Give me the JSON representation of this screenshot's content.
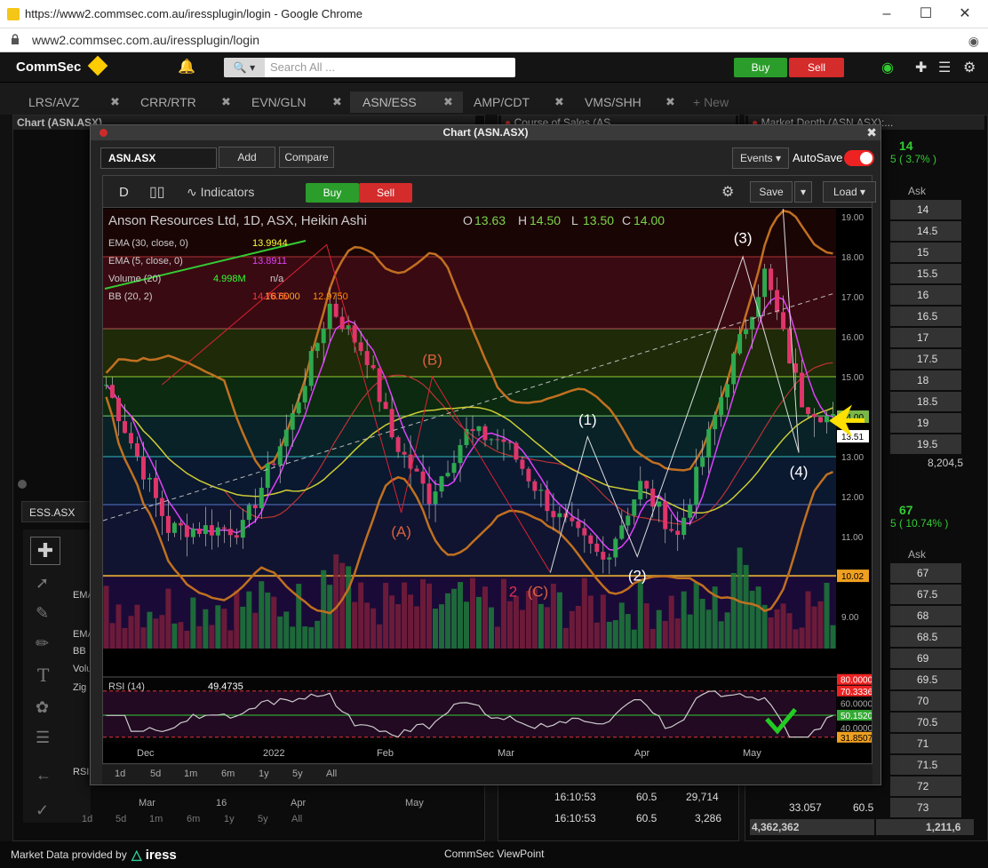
{
  "window": {
    "title": "https://www2.commsec.com.au/iressplugin/login - Google Chrome",
    "url": "www2.commsec.com.au/iressplugin/login"
  },
  "topbar": {
    "logo": "CommSec",
    "search_placeholder": "Search All ...",
    "buy": "Buy",
    "sell": "Sell"
  },
  "tabs": [
    "LRS/AVZ",
    "CRR/RTR",
    "EVN/GLN",
    "ASN/ESS",
    "AMP/CDT",
    "VMS/SHH"
  ],
  "new_tab": "+ New",
  "panels": {
    "chart_bg": "Chart (ASN.ASX)",
    "cos": "Course of Sales (AS...",
    "depth": "Market Depth (ASN.ASX):..."
  },
  "depth": {
    "change1": "14",
    "change1_pct": "5 ( 3.7% )",
    "ask_header": "Ask",
    "asks1": [
      "14",
      "14.5",
      "15",
      "15.5",
      "16",
      "16.5",
      "17",
      "17.5",
      "18",
      "18.5",
      "19",
      "19.5"
    ],
    "total1": "8,204,5",
    "change2": "67",
    "change2_pct": "5 ( 10.74% )",
    "ask_header2": "Ask",
    "asks2": [
      "67",
      "67.5",
      "68",
      "68.5",
      "69",
      "69.5",
      "70",
      "70.5",
      "71",
      "71.5",
      "72",
      "73"
    ],
    "row_bot_a": "33.057",
    "row_bot_b": "60.5",
    "total2a": "4,362,362",
    "total2b": "1,211,6"
  },
  "cos_rows": [
    {
      "time": "16:10:53",
      "price": "60.5",
      "vol": "29,714"
    },
    {
      "time": "16:10:53",
      "price": "60.5",
      "vol": "3,286"
    }
  ],
  "bg_chart": {
    "symbol": "ESS.ASX",
    "labels": [
      "EMA",
      "EMA",
      "BB",
      "Volu",
      "Zig",
      "RSI"
    ],
    "x_labels": [
      "Mar",
      "16",
      "Apr",
      "May"
    ],
    "ranges": [
      "1d",
      "5d",
      "1m",
      "6m",
      "1y",
      "5y",
      "All"
    ]
  },
  "chart": {
    "window_title": "Chart (ASN.ASX)",
    "symbol_input": "ASN.ASX",
    "add": "Add",
    "compare": "Compare",
    "events": "Events",
    "autosave": "AutoSave",
    "period": "D",
    "indicators": "Indicators",
    "buy": "Buy",
    "sell": "Sell",
    "save": "Save",
    "load": "Load",
    "header": "Anson Resources Ltd, 1D, ASX, Heikin Ashi",
    "ohlc": {
      "o_label": "O",
      "o": "13.63",
      "h_label": "H",
      "h": "14.50",
      "l_label": "L",
      "l": "13.50",
      "c_label": "C",
      "c": "14.00"
    },
    "legend": [
      {
        "label": "EMA (30, close, 0)",
        "v1": "13.9944",
        "c1": "#ffff33"
      },
      {
        "label": "EMA (5, close, 0)",
        "v1": "13.8911",
        "c1": "#e040fb"
      },
      {
        "label": "Volume (20)",
        "v1": "4.998M",
        "c1": "#33ff33",
        "v2": "n/a"
      },
      {
        "label": "BB (20, 2)",
        "v1": "14.7875",
        "c1": "#ff3333",
        "v2": "16.6000",
        "c2": "#ffa030",
        "v3": "12.9750",
        "c3": "#ff8c00"
      }
    ],
    "price_ticks": [
      "19.00",
      "18.00",
      "17.00",
      "16.00",
      "15.00",
      "14.00",
      "13.51",
      "13.00",
      "12.00",
      "11.00",
      "10.02",
      "9.00"
    ],
    "rsi": {
      "label": "RSI (14)",
      "value": "49.4735",
      "ticks": [
        "80.0000",
        "70.3336",
        "60.0000",
        "50.1520",
        "40.0000",
        "31.8507"
      ]
    },
    "x_labels": [
      "Dec",
      "2022",
      "Feb",
      "Mar",
      "Apr",
      "May"
    ],
    "wave_labels": [
      "(3)",
      "(B)",
      "(1)",
      "(4)",
      "(A)",
      "(2)",
      "2",
      "(C)",
      "1"
    ],
    "ranges": [
      "1d",
      "5d",
      "1m",
      "6m",
      "1y",
      "5y",
      "All"
    ]
  },
  "footer": {
    "provider": "Market Data provided by",
    "brand": "iress",
    "app": "CommSec ViewPoint"
  },
  "colors": {
    "buy": "#2a9d2a",
    "sell": "#d42b2b",
    "accent": "#ffcc00"
  }
}
